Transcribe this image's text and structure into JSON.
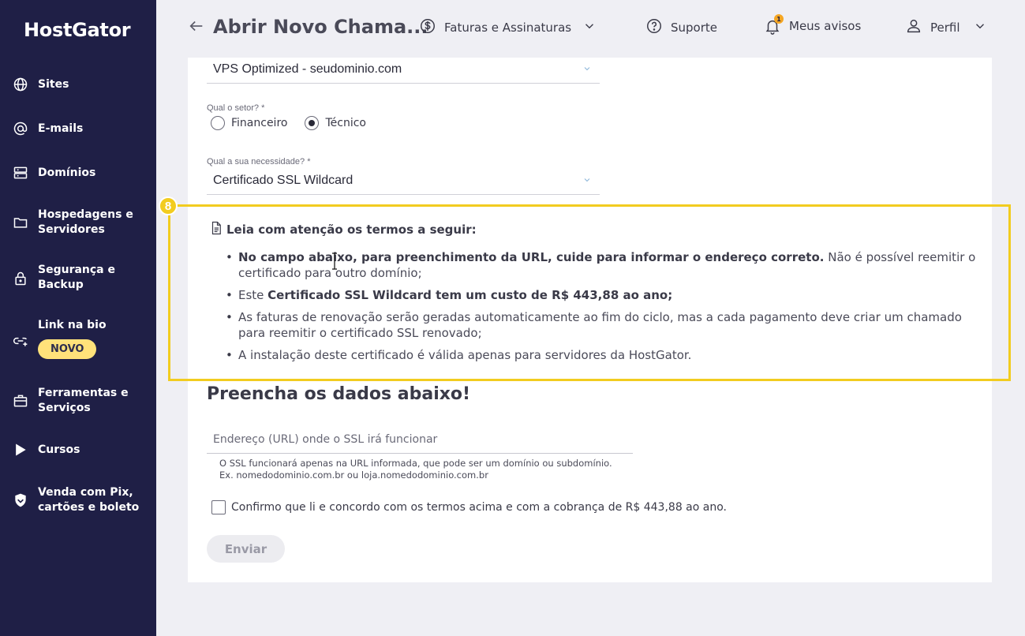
{
  "brand": {
    "name": "HostGator"
  },
  "sidebar": {
    "items": [
      {
        "label": "Sites",
        "icon": "globe-icon"
      },
      {
        "label": "E-mails",
        "icon": "at-icon"
      },
      {
        "label": "Domínios",
        "icon": "server-icon"
      },
      {
        "label": "Hospedagens e Servidores",
        "icon": "folder-icon"
      },
      {
        "label": "Segurança e Backup",
        "icon": "lock-icon"
      },
      {
        "label": "Link na bio",
        "icon": "link-icon",
        "badge": "NOVO"
      },
      {
        "label": "Ferramentas e Serviços",
        "icon": "toolbox-icon"
      },
      {
        "label": "Cursos",
        "icon": "play-icon"
      },
      {
        "label": "Venda com Pix, cartões e boleto",
        "icon": "shield-icon"
      }
    ]
  },
  "header": {
    "title": "Abrir Novo Chama...",
    "billing": "Faturas e Assinaturas",
    "support": "Suporte",
    "notices": "Meus avisos",
    "notices_count": "1",
    "profile": "Perfil"
  },
  "form": {
    "plan_value": "VPS Optimized - seudominio.com",
    "sector_label": "Qual o setor? *",
    "sector_options": [
      "Financeiro",
      "Técnico"
    ],
    "sector_selected": "Técnico",
    "need_label": "Qual a sua necessidade? *",
    "need_value": "Certificado SSL Wildcard",
    "step_number": "8",
    "terms_title": "Leia com atenção os termos a seguir:",
    "terms": [
      {
        "bold": "No campo abaixo, para preenchimento da URL, cuide para informar o endereço correto.",
        "text": " Não é possível reemitir o certificado para outro domínio;"
      },
      {
        "prefix": "Este ",
        "bold": "Certificado SSL Wildcard tem um custo de R$ 443,88 ao ano;",
        "text": ""
      },
      {
        "text": "As faturas de renovação serão geradas automaticamente ao fim do ciclo, mas a cada pagamento deve criar um chamado para reemitir o certificado SSL renovado;"
      },
      {
        "text": "A instalação deste certificado é válida apenas para servidores da HostGator."
      }
    ],
    "section_title": "Preencha os dados abaixo!",
    "url_placeholder": "Endereço (URL) onde o SSL irá funcionar",
    "helper_line1": "O SSL funcionará apenas na URL informada, que pode ser um domínio ou subdomínio.",
    "helper_line2": "Ex. nomedodominio.com.br ou loja.nomedodominio.com.br",
    "confirm_label": "Confirmo que li e concordo com os termos acima e com a cobrança de R$ 443,88 ao ano.",
    "submit_label": "Enviar"
  },
  "colors": {
    "sidebar_bg": "#1f1f46",
    "highlight": "#f2cc1f",
    "badge": "#ffe27a",
    "page_bg": "#efeff4"
  }
}
